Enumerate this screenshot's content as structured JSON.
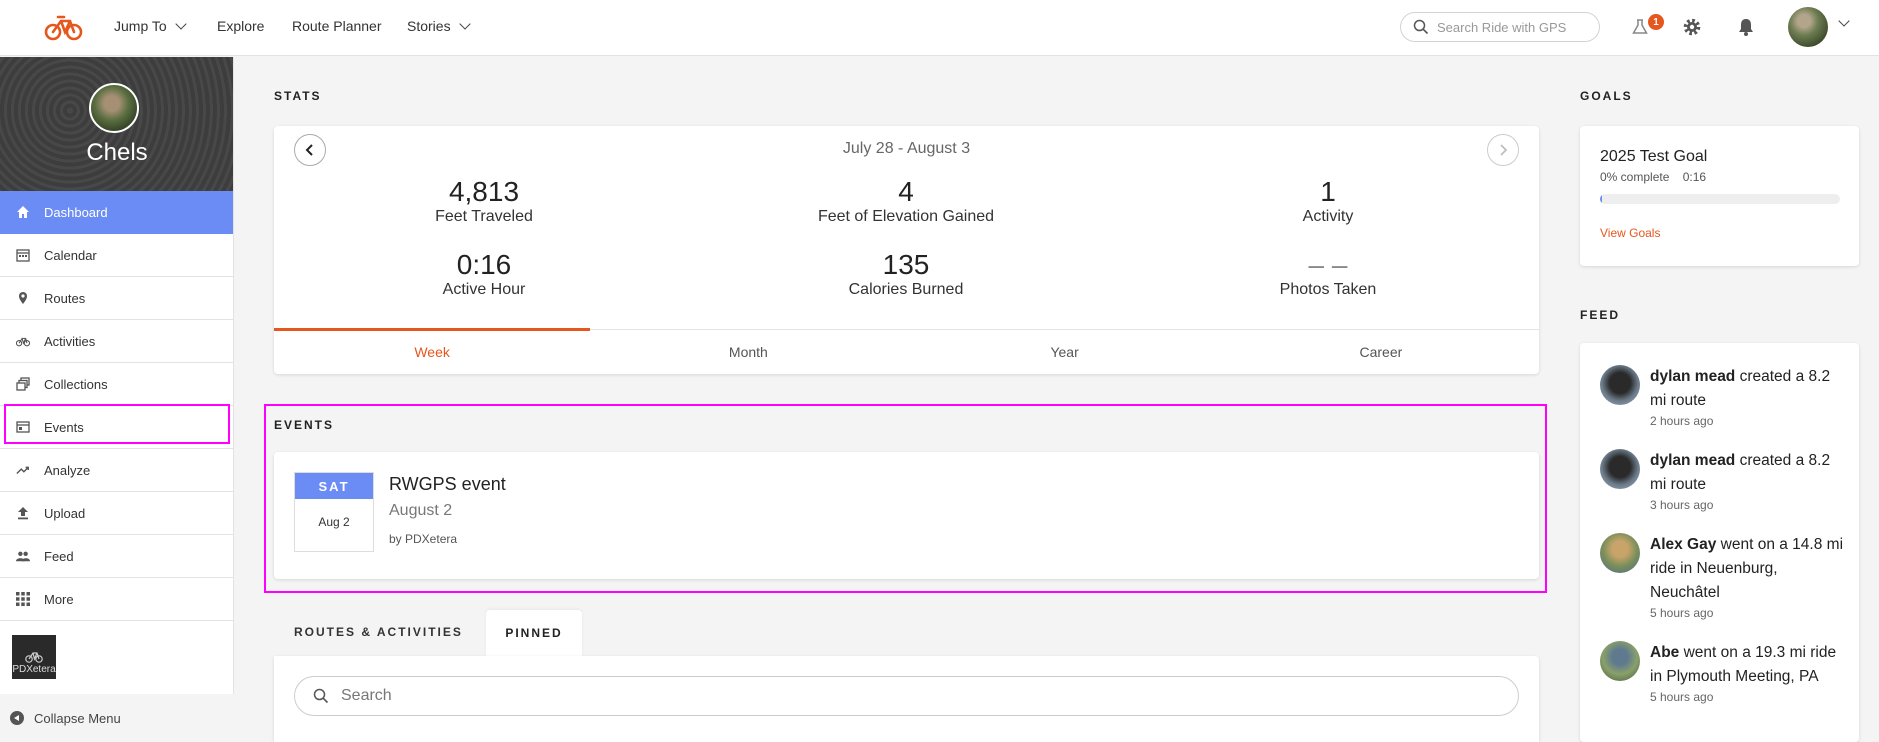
{
  "topbar": {
    "nav": [
      {
        "label": "Jump To",
        "dropdown": true
      },
      {
        "label": "Explore",
        "dropdown": false
      },
      {
        "label": "Route Planner",
        "dropdown": false
      },
      {
        "label": "Stories",
        "dropdown": true
      }
    ],
    "search_placeholder": "Search Ride with GPS",
    "notification_badge": "1",
    "accent_color": "#e5571e"
  },
  "sidebar": {
    "user_name": "Chels",
    "items": [
      {
        "label": "Dashboard",
        "icon": "home-icon",
        "active": true
      },
      {
        "label": "Calendar",
        "icon": "calendar-icon"
      },
      {
        "label": "Routes",
        "icon": "pin-icon"
      },
      {
        "label": "Activities",
        "icon": "bike-icon"
      },
      {
        "label": "Collections",
        "icon": "collections-icon"
      },
      {
        "label": "Events",
        "icon": "events-icon"
      },
      {
        "label": "Analyze",
        "icon": "trend-icon"
      },
      {
        "label": "Upload",
        "icon": "upload-icon"
      },
      {
        "label": "Feed",
        "icon": "people-icon"
      },
      {
        "label": "More",
        "icon": "grid-icon"
      }
    ],
    "org_name": "PDXetera",
    "collapse_label": "Collapse Menu",
    "active_color": "#6c8cf5"
  },
  "stats": {
    "heading": "STATS",
    "range": "July 28 - August 3",
    "items": [
      {
        "value": "4,813",
        "label": "Feet Traveled"
      },
      {
        "value": "4",
        "label": "Feet of Elevation Gained"
      },
      {
        "value": "1",
        "label": "Activity"
      },
      {
        "value": "0:16",
        "label": "Active Hour"
      },
      {
        "value": "135",
        "label": "Calories Burned"
      },
      {
        "value": "– –",
        "label": "Photos Taken"
      }
    ],
    "tabs": [
      "Week",
      "Month",
      "Year",
      "Career"
    ],
    "active_tab": "Week"
  },
  "events": {
    "heading": "EVENTS",
    "event": {
      "day": "SAT",
      "date_short": "Aug 2",
      "title": "RWGPS event",
      "date_long": "August 2",
      "by": "by PDXetera"
    }
  },
  "list": {
    "tabs": [
      "ROUTES & ACTIVITIES",
      "PINNED"
    ],
    "active_tab": "PINNED",
    "search_placeholder": "Search"
  },
  "goals": {
    "heading": "GOALS",
    "title": "2025 Test Goal",
    "subtitle": "0% complete    0:16",
    "progress": 0.0,
    "link": "View Goals"
  },
  "feed": {
    "heading": "FEED",
    "items": [
      {
        "user": "dylan mead",
        "text": " created a 8.2 mi route",
        "time": "2 hours ago"
      },
      {
        "user": "dylan mead",
        "text": " created a 8.2 mi route",
        "time": "3 hours ago"
      },
      {
        "user": "Alex Gay",
        "text": " went on a 14.8 mi ride in Neuenburg, Neuchâtel",
        "time": "5 hours ago"
      },
      {
        "user": "Abe",
        "text": " went on a 19.3 mi ride in Plymouth Meeting, PA",
        "time": "5 hours ago"
      }
    ]
  }
}
